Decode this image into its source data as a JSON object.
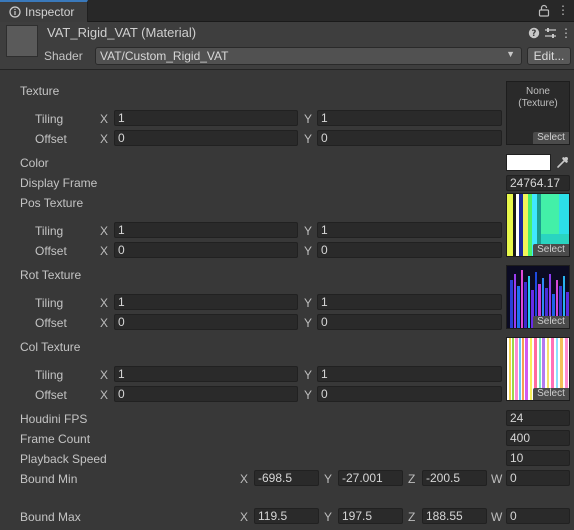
{
  "window": {
    "tab_label": "Inspector",
    "tab_icon": "info-icon",
    "lock_icon": "lock-icon",
    "menu_icon": "kebab-menu-icon"
  },
  "header": {
    "title": "VAT_Rigid_VAT (Material)",
    "shader_label": "Shader",
    "shader_value": "VAT/Custom_Rigid_VAT",
    "edit_label": "Edit...",
    "icons": [
      "help-icon",
      "presets-icon",
      "kebab-menu-icon"
    ]
  },
  "labels": {
    "tiling": "Tiling",
    "offset": "Offset",
    "x": "X",
    "y": "Y",
    "z": "Z",
    "w": "W",
    "select": "Select",
    "none_line1": "None",
    "none_line2": "(Texture)"
  },
  "texture": {
    "label": "Texture",
    "tiling_x": "1",
    "tiling_y": "1",
    "offset_x": "0",
    "offset_y": "0"
  },
  "color": {
    "label": "Color",
    "value": "#ffffff"
  },
  "display_frame": {
    "label": "Display Frame",
    "value": "24764.17"
  },
  "pos_texture": {
    "label": "Pos Texture",
    "tiling_x": "1",
    "tiling_y": "1",
    "offset_x": "0",
    "offset_y": "0"
  },
  "rot_texture": {
    "label": "Rot Texture",
    "tiling_x": "1",
    "tiling_y": "1",
    "offset_x": "0",
    "offset_y": "0"
  },
  "col_texture": {
    "label": "Col Texture",
    "tiling_x": "1",
    "tiling_y": "1",
    "offset_x": "0",
    "offset_y": "0"
  },
  "houdini_fps": {
    "label": "Houdini FPS",
    "value": "24"
  },
  "frame_count": {
    "label": "Frame Count",
    "value": "400"
  },
  "playback_speed": {
    "label": "Playback Speed",
    "value": "10"
  },
  "bound_min": {
    "label": "Bound Min",
    "x": "-698.5",
    "y": "-27.001",
    "z": "-200.5",
    "w": "0"
  },
  "bound_max": {
    "label": "Bound Max",
    "x": "119.5",
    "y": "197.5",
    "z": "188.55",
    "w": "0"
  }
}
